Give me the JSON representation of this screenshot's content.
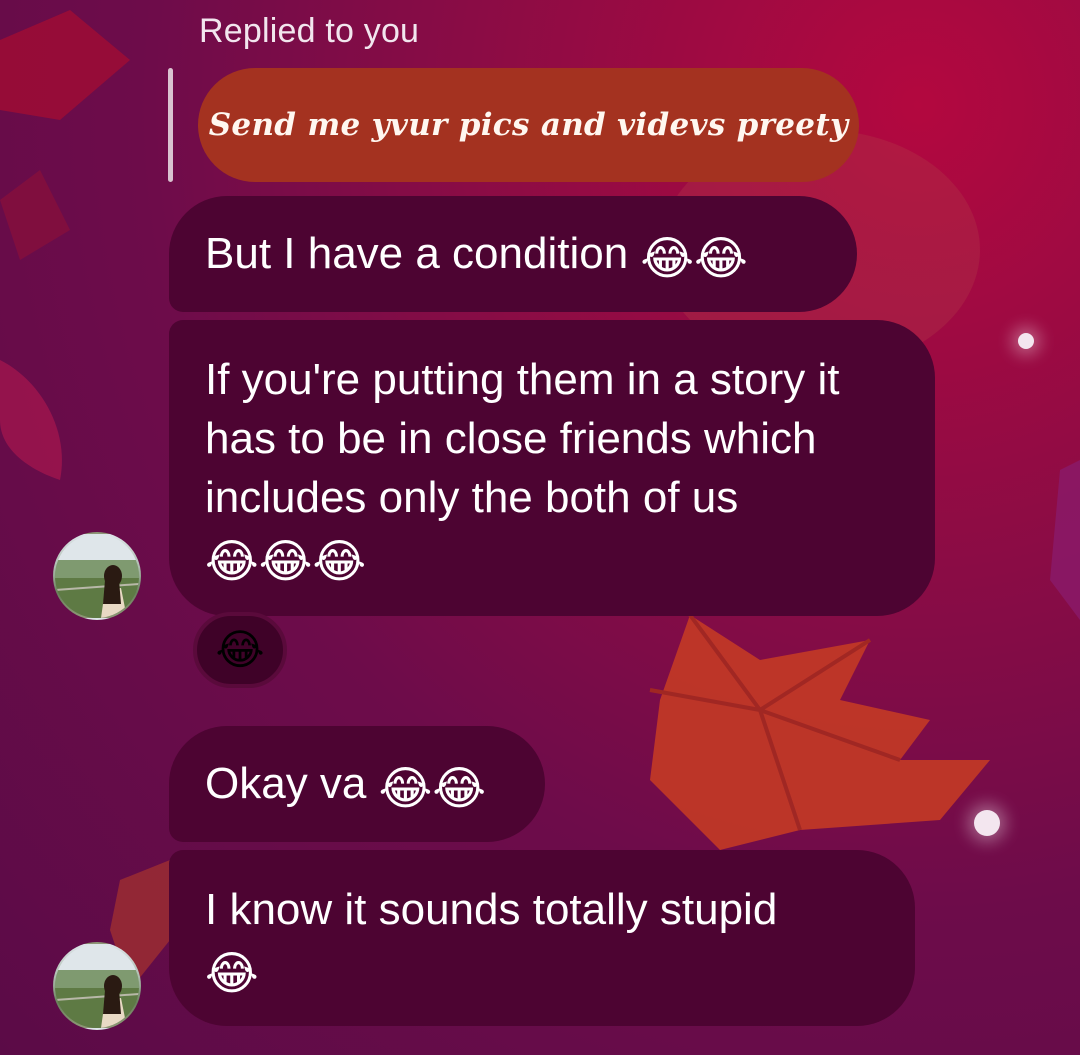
{
  "reply": {
    "label": "Replied to you",
    "quoted_text": "Send me yvur pics and videvs preety"
  },
  "messages": [
    {
      "id": "msg1",
      "text": "But I have a condition",
      "emojis": "😂😂"
    },
    {
      "id": "msg2",
      "text": "If you're putting them in a story it has to be in close friends which includes only the both of us",
      "emojis": "😂😂😂"
    },
    {
      "id": "msg3",
      "text": "Okay va",
      "emojis": "😂😂"
    },
    {
      "id": "msg4",
      "text": "I know it sounds totally stupid",
      "emojis": "😂"
    }
  ],
  "reaction": {
    "emoji": "😂"
  },
  "colors": {
    "bubble": "#4d0432",
    "replied_bubble": "#a43220",
    "background": "#6d0c4a"
  },
  "icons": [
    "avatar-photo",
    "face-with-tears-of-joy-emoji"
  ]
}
